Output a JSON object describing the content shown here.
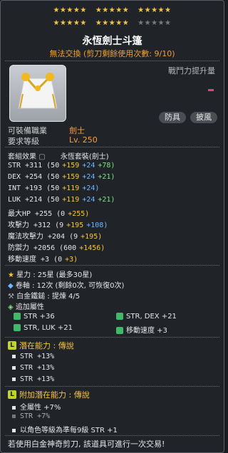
{
  "stars": {
    "row1": {
      "on": 15,
      "off": 0
    },
    "row2": {
      "on": 10,
      "off": 5
    }
  },
  "item": {
    "name": "永恆劍士斗篷",
    "trade_status": "無法交換 (剪刀剩餘使用次數: 9/10)"
  },
  "header": {
    "damage_label": "戰鬥力提升量"
  },
  "tags": {
    "type": "防具",
    "slot": "披風"
  },
  "requirements": {
    "job_label": "可裝備職業",
    "job_value": "劍士",
    "level_label": "要求等級",
    "level_value": "Lv. 250"
  },
  "set": {
    "label": "套組效果",
    "name": "永恆套裝(劍士)"
  },
  "stats": [
    {
      "name": "STR",
      "total": "+311",
      "base": "(50",
      "flame": "+159",
      "scroll": "+24",
      "extra": "+78)"
    },
    {
      "name": "DEX",
      "total": "+254",
      "base": "(50",
      "flame": "+159",
      "scroll": "+24",
      "extra": "+21)"
    },
    {
      "name": "INT",
      "total": "+193",
      "base": "(50",
      "flame": "+119",
      "scroll": "+24)",
      "extra": ""
    },
    {
      "name": "LUK",
      "total": "+214",
      "base": "(50",
      "flame": "+119",
      "scroll": "+24",
      "extra": "+21)"
    },
    {
      "name": "最大HP",
      "total": "+255",
      "base": "(0",
      "flame": "+255)",
      "scroll": "",
      "extra": ""
    },
    {
      "name": "攻擊力",
      "total": "+312",
      "base": "(9",
      "flame": "+195",
      "scroll": "+108)",
      "extra": ""
    },
    {
      "name": "魔法攻擊力",
      "total": "+204",
      "base": "(9",
      "flame": "+195)",
      "scroll": "",
      "extra": ""
    },
    {
      "name": "防禦力",
      "total": "+2056",
      "base": "(600",
      "flame": "+1456)",
      "scroll": "",
      "extra": ""
    },
    {
      "name": "移動速度",
      "total": "+3",
      "base": "(0",
      "flame": "+3)",
      "scroll": "",
      "extra": ""
    }
  ],
  "upgrades": {
    "stars": "星力 : 25星 (最多30星)",
    "scrolls": "卷軸 : 12次 (剩餘0次, 可恢復0次)",
    "hammer": "白金鐵鎚 : 提煉 4/5"
  },
  "extra_option": {
    "label": "追加屬性",
    "items": [
      "STR +36",
      "STR, DEX +21",
      "STR, LUK +21",
      "移動速度 +3"
    ]
  },
  "potential": {
    "label": "潛在能力 : 傳說",
    "badge": "L",
    "lines": [
      "STR +13%",
      "STR +13%",
      "STR +13%"
    ]
  },
  "bonus_potential": {
    "label": "附加潛在能力 : 傳說",
    "badge": "L",
    "lines": [
      "全屬性 +7%",
      "STR +7%",
      "以角色等級為準每9級 STR +1"
    ]
  },
  "footer": "若使用白金神奇剪刀, 該道具可進行一次交易!",
  "colors": {
    "star_on": "#f5c542",
    "flame": "#f5c542",
    "scroll": "#6fb8ff",
    "extra": "#7de07d",
    "trade": "#f0a030",
    "legend": "#c2d428"
  }
}
